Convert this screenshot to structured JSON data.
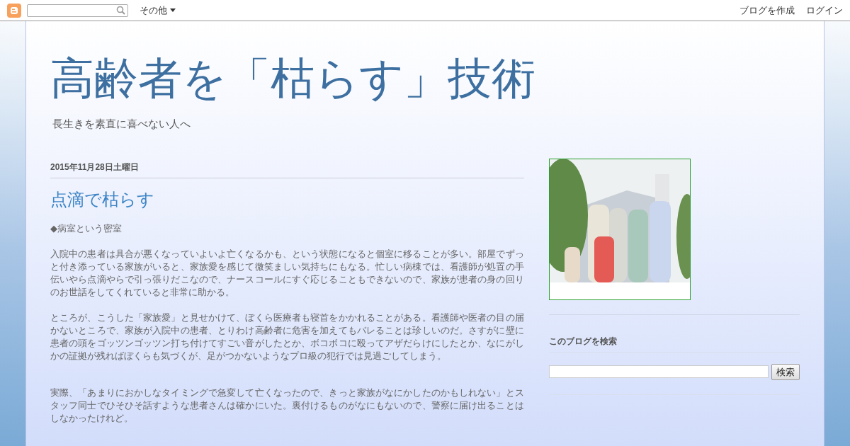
{
  "navbar": {
    "more_menu": "その他",
    "links": [
      "ブログを作成",
      "ログイン"
    ]
  },
  "blog": {
    "title": "高齢者を「枯らす」技術",
    "description": "長生きを素直に喜べない人へ"
  },
  "post": {
    "date": "2015年11月28日土曜日",
    "title": "点滴で枯らす",
    "paragraphs": [
      "◆病室という密室",
      "入院中の患者は具合が悪くなっていよいよ亡くなるかも、という状態になると個室に移ることが多い。部屋でずっと付き添っている家族がいると、家族愛を感じて微笑ましい気持ちにもなる。忙しい病棟では、看護師が処置の手伝いやら点滴やらで引っ張りだこなので、ナースコールにすぐ応じることもできないので、家族が患者の身の回りのお世話をしてくれていると非常に助かる。",
      "ところが、こうした「家族愛」と見せかけて、ぼくら医療者も寝首をかかれることがある。看護師や医者の目の届かないところで、家族が入院中の患者、とりわけ高齢者に危害を加えてもバレることは珍しいのだ。さすがに壁に患者の頭をゴッツンゴッツン打ち付けてすごい音がしたとか、ボコボコに殴ってアザだらけにしたとか、なにがしかの証拠が残ればぼくらも気づくが、足がつかないようなプロ級の犯行では見過ごしてしまう。",
      "実際、「あまりにおかしなタイミングで急変して亡くなったので、きっと家族がなにかしたのかもしれない」とスタッフ同士でひそひそ話すような患者さんは確かにいた。裏付けるものがなにもないので、警察に届け出ることはしなかったけれど。"
    ]
  },
  "sidebar": {
    "search": {
      "heading": "このブログを検索",
      "button": "検索"
    }
  }
}
